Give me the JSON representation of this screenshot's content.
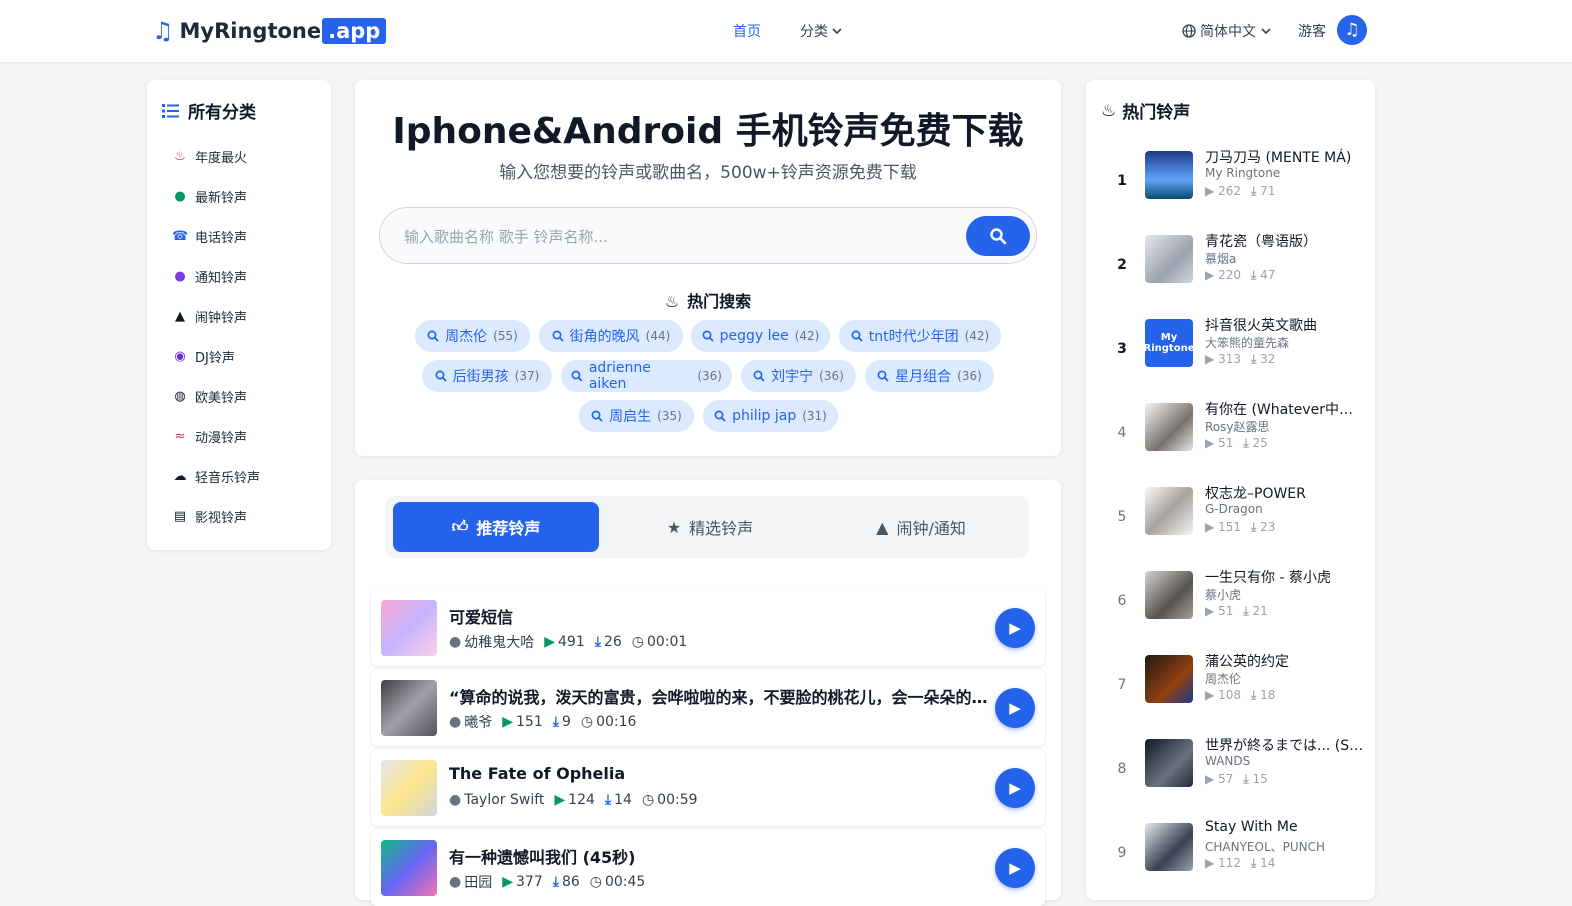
{
  "header": {
    "logo_name": "MyRingtone",
    "logo_tld": ".app",
    "nav_home": "首页",
    "nav_category": "分类",
    "language": "简体中文",
    "guest": "游客"
  },
  "sidebar": {
    "title": "所有分类",
    "items": [
      {
        "label": "年度最火",
        "icon": "flame-icon",
        "color": "#dc2626"
      },
      {
        "label": "最新铃声",
        "icon": "clock-icon",
        "color": "#059669"
      },
      {
        "label": "电话铃声",
        "icon": "phone-icon",
        "color": "#2563eb"
      },
      {
        "label": "通知铃声",
        "icon": "chat-icon",
        "color": "#7c3aed"
      },
      {
        "label": "闹钟铃声",
        "icon": "bell-icon",
        "color": "#111827"
      },
      {
        "label": "DJ铃声",
        "icon": "disc-icon",
        "color": "#6d28d9"
      },
      {
        "label": "欧美铃声",
        "icon": "globe-icon",
        "color": "#111827"
      },
      {
        "label": "动漫铃声",
        "icon": "dragon-icon",
        "color": "#db2777"
      },
      {
        "label": "轻音乐铃声",
        "icon": "cloud-icon",
        "color": "#111827"
      },
      {
        "label": "影视铃声",
        "icon": "film-icon",
        "color": "#111827"
      }
    ]
  },
  "hero": {
    "title": "Iphone&Android 手机铃声免费下载",
    "subtitle": "输入您想要的铃声或歌曲名，500w+铃声资源免费下载",
    "search_placeholder": "输入歌曲名称 歌手 铃声名称...",
    "hot_title": "热门搜索",
    "tags": [
      {
        "label": "周杰伦",
        "count": "(55)"
      },
      {
        "label": "街角的晚风",
        "count": "(44)"
      },
      {
        "label": "peggy lee",
        "count": "(42)"
      },
      {
        "label": "tnt时代少年团",
        "count": "(42)"
      },
      {
        "label": "后街男孩",
        "count": "(37)"
      },
      {
        "label": "adrienne aiken",
        "count": "(36)"
      },
      {
        "label": "刘宇宁",
        "count": "(36)"
      },
      {
        "label": "星月组合",
        "count": "(36)"
      },
      {
        "label": "周启生",
        "count": "(35)"
      },
      {
        "label": "philip jap",
        "count": "(31)"
      }
    ]
  },
  "tabs": [
    {
      "label": "推荐铃声",
      "icon": "thumbs-up-icon"
    },
    {
      "label": "精选铃声",
      "icon": "star-icon"
    },
    {
      "label": "闹钟/通知",
      "icon": "bell-icon"
    }
  ],
  "songs": [
    {
      "title": "可爱短信",
      "artist": "幼稚鬼大哈",
      "plays": "491",
      "downloads": "26",
      "duration": "00:01"
    },
    {
      "title": "“算命的说我，泼天的富贵，会哗啦啦的来，不要脸的桃花儿，会一朵朵的开”",
      "artist": "曦爷",
      "plays": "151",
      "downloads": "9",
      "duration": "00:16"
    },
    {
      "title": "The Fate of Ophelia",
      "artist": "Taylor Swift",
      "plays": "124",
      "downloads": "14",
      "duration": "00:59"
    },
    {
      "title": "有一种遗憾叫我们 (45秒)",
      "artist": "田园",
      "plays": "377",
      "downloads": "86",
      "duration": "00:45"
    }
  ],
  "hot_ringtones": {
    "title": "热门铃声",
    "items": [
      {
        "rank": "1",
        "title": "刀马刀马 (MENTE MÁ)",
        "artist": "My Ringtone",
        "plays": "262",
        "downloads": "71"
      },
      {
        "rank": "2",
        "title": "青花瓷（粤语版）",
        "artist": "慕烟a",
        "plays": "220",
        "downloads": "47"
      },
      {
        "rank": "3",
        "title": "抖音很火英文歌曲",
        "artist": "大笨熊的童先森",
        "plays": "313",
        "downloads": "32",
        "thumb_text": "My Ringtone"
      },
      {
        "rank": "4",
        "title": "有你在 (Whatever中文版)",
        "artist": "Rosy赵露思",
        "plays": "51",
        "downloads": "25"
      },
      {
        "rank": "5",
        "title": "权志龙–POWER",
        "artist": "G-Dragon",
        "plays": "151",
        "downloads": "23"
      },
      {
        "rank": "6",
        "title": "一生只有你 - 蔡小虎",
        "artist": "蔡小虎",
        "plays": "51",
        "downloads": "21"
      },
      {
        "rank": "7",
        "title": "蒲公英的约定",
        "artist": "周杰伦",
        "plays": "108",
        "downloads": "18"
      },
      {
        "rank": "8",
        "title": "世界が終るまでは... (SLAM DUNK)",
        "artist": "WANDS",
        "plays": "57",
        "downloads": "15"
      },
      {
        "rank": "9",
        "title": "Stay With Me",
        "artist": "CHANYEOL、PUNCH",
        "plays": "112",
        "downloads": "14"
      }
    ]
  },
  "colors": {
    "accent": "#2563eb",
    "play": "#059669"
  }
}
